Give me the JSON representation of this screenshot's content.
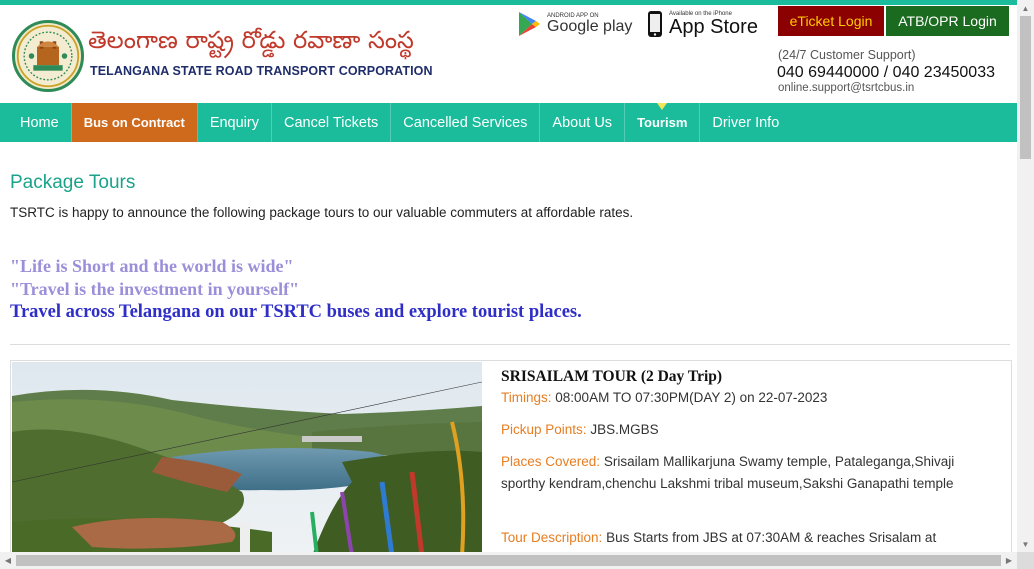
{
  "header": {
    "brand_telugu": "తెలంగాణ రాష్ట్ర రోడ్డు రవాణా సంస్థ",
    "brand_english": "TELANGANA STATE ROAD TRANSPORT CORPORATION",
    "google_play_small": "ANDROID APP ON",
    "google_play_label": "Google play",
    "app_store_small": "Available on the iPhone",
    "app_store_label": "App Store",
    "eticket_login": "eTicket Login",
    "atb_login": "ATB/OPR Login",
    "support_label": "(24/7 Customer Support)",
    "support_phone": "040 69440000 / 040 23450033",
    "support_email": "online.support@tsrtcbus.in"
  },
  "nav": {
    "items": [
      {
        "label": "Home"
      },
      {
        "label": "Bus on Contract"
      },
      {
        "label": "Enquiry"
      },
      {
        "label": "Cancel Tickets"
      },
      {
        "label": "Cancelled Services"
      },
      {
        "label": "About Us"
      },
      {
        "label": "Tourism"
      },
      {
        "label": "Driver Info"
      }
    ]
  },
  "main": {
    "title": "Package Tours",
    "intro": "TSRTC is happy to announce the following package tours to our valuable commuters at affordable rates.",
    "quote1": "\"Life is Short and the world is wide\"",
    "quote2": "\"Travel is the investment in yourself\"",
    "quote3": "Travel across Telangana on our TSRTC buses and explore tourist places."
  },
  "tour": {
    "title": "SRISAILAM TOUR (2 Day Trip)",
    "timings_label": "Timings:",
    "timings_value": "08:00AM TO 07:30PM(DAY 2) on 22-07-2023",
    "pickup_label": "Pickup Points:",
    "pickup_value": "JBS.MGBS",
    "places_label": "Places Covered:",
    "places_value": "Srisailam Mallikarjuna Swamy temple, Pataleganga,Shivaji sporthy kendram,chenchu Lakshmi tribal museum,Sakshi Ganapathi temple",
    "description_label": "Tour Description:",
    "description_value": "Bus Starts from JBS at 07:30AM & reaches Srisalam at"
  },
  "colors": {
    "accent": "#1abc9c",
    "active_nav": "#cf6a1d",
    "eticket_bg": "#8b0000",
    "atb_bg": "#1a6b1f",
    "label_orange": "#e67e22"
  }
}
